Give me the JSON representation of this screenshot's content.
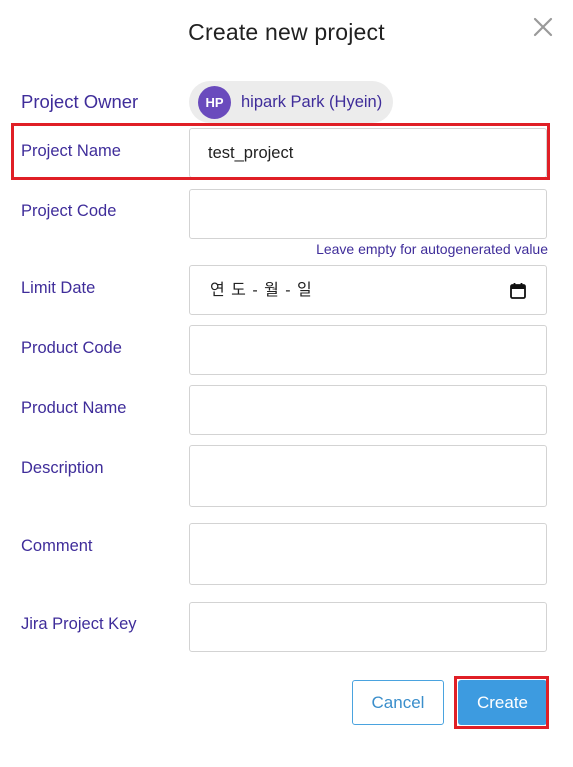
{
  "dialog": {
    "title": "Create new project",
    "close_icon": "close-icon"
  },
  "owner": {
    "label": "Project Owner",
    "avatar_initials": "HP",
    "name": "hipark Park (Hyein)",
    "avatar_color": "#6a4bbd"
  },
  "fields": {
    "project_name": {
      "label": "Project Name",
      "value": "test_project"
    },
    "project_code": {
      "label": "Project Code",
      "value": "",
      "hint": "Leave empty for autogenerated value"
    },
    "limit_date": {
      "label": "Limit Date",
      "placeholder": "연 도 - 월 - 일",
      "icon": "calendar-icon"
    },
    "product_code": {
      "label": "Product Code",
      "value": ""
    },
    "product_name": {
      "label": "Product Name",
      "value": ""
    },
    "description": {
      "label": "Description",
      "value": ""
    },
    "comment": {
      "label": "Comment",
      "value": ""
    },
    "jira_project_key": {
      "label": "Jira Project Key",
      "value": ""
    }
  },
  "actions": {
    "cancel_label": "Cancel",
    "create_label": "Create"
  },
  "colors": {
    "label": "#3f2d9a",
    "primary": "#3d9be0",
    "highlight": "#e01f26"
  }
}
